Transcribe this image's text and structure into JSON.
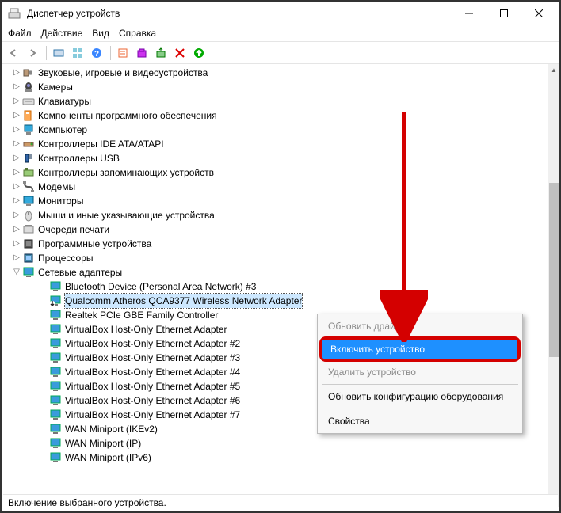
{
  "window": {
    "title": "Диспетчер устройств"
  },
  "menu": {
    "file": "Файл",
    "action": "Действие",
    "view": "Вид",
    "help": "Справка"
  },
  "categories": [
    "Звуковые, игровые и видеоустройства",
    "Камеры",
    "Клавиатуры",
    "Компоненты программного обеспечения",
    "Компьютер",
    "Контроллеры IDE ATA/ATAPI",
    "Контроллеры USB",
    "Контроллеры запоминающих устройств",
    "Модемы",
    "Мониторы",
    "Мыши и иные указывающие устройства",
    "Очереди печати",
    "Программные устройства",
    "Процессоры"
  ],
  "net_category": "Сетевые адаптеры",
  "net_devices": [
    "Bluetooth Device (Personal Area Network) #3",
    "Qualcomm Atheros QCA9377 Wireless Network Adapter",
    "Realtek PCIe GBE Family Controller",
    "VirtualBox Host-Only Ethernet Adapter",
    "VirtualBox Host-Only Ethernet Adapter #2",
    "VirtualBox Host-Only Ethernet Adapter #3",
    "VirtualBox Host-Only Ethernet Adapter #4",
    "VirtualBox Host-Only Ethernet Adapter #5",
    "VirtualBox Host-Only Ethernet Adapter #6",
    "VirtualBox Host-Only Ethernet Adapter #7",
    "WAN Miniport (IKEv2)",
    "WAN Miniport (IP)",
    "WAN Miniport (IPv6)"
  ],
  "selected_device_index": 1,
  "disabled_device_index": 1,
  "context_menu": {
    "update_driver": "Обновить драйвер",
    "enable_device": "Включить устройство",
    "remove_device": "Удалить устройство",
    "refresh_config": "Обновить конфигурацию оборудования",
    "properties": "Свойства"
  },
  "status": "Включение выбранного устройства."
}
